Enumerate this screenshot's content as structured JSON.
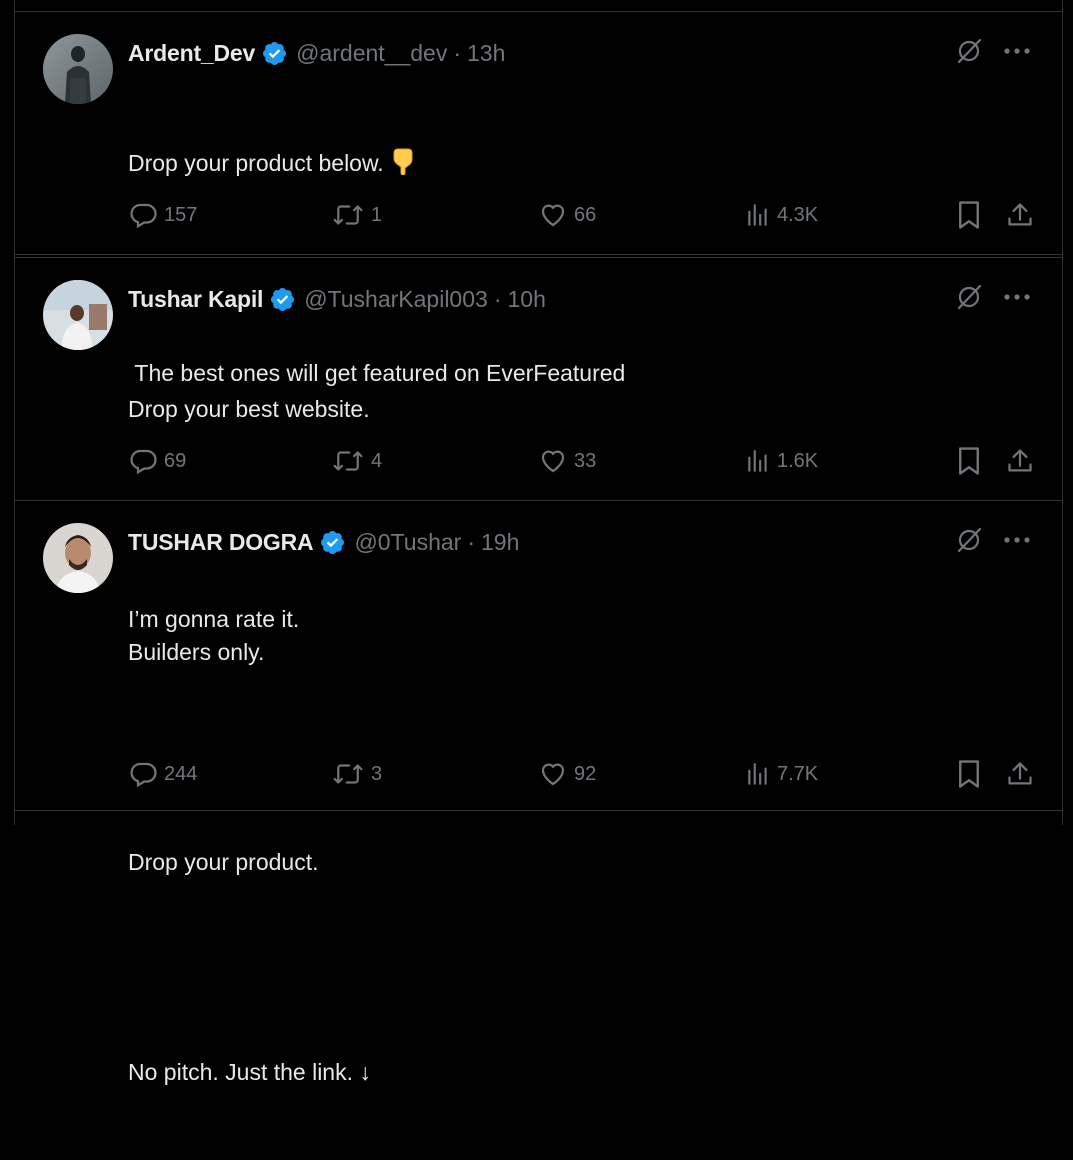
{
  "tweets": [
    {
      "display_name": "Ardent_Dev",
      "handle": "@ardent__dev",
      "separator": "·",
      "time": "13h",
      "lines": [
        "Drop your product below.",
        "",
        " The best ones will get featured on EverFeatured"
      ],
      "emoji": "👇",
      "replies": "157",
      "retweets": "1",
      "likes": "66",
      "views": "4.3K"
    },
    {
      "display_name": "Tushar Kapil",
      "handle": "@TusharKapil003",
      "separator": "·",
      "time": "10h",
      "lines": [
        "Drop your best website.",
        "",
        "I’m gonna rate it."
      ],
      "replies": "69",
      "retweets": "4",
      "likes": "33",
      "views": "1.6K"
    },
    {
      "display_name": "TUSHAR DOGRA",
      "handle": "@0Tushar",
      "separator": "·",
      "time": "19h",
      "lines": [
        "Builders only.",
        "",
        "Drop your product.",
        "",
        "No pitch. Just the link. ↓"
      ],
      "replies": "244",
      "retweets": "3",
      "likes": "92",
      "views": "7.7K"
    }
  ],
  "colors": {
    "background": "#000000",
    "text": "#e7e9ea",
    "muted": "#71767b",
    "border": "#2f3336",
    "verified": "#1d9bf0"
  },
  "icons": [
    "verified-badge-icon",
    "grok-icon",
    "more-icon",
    "reply-icon",
    "retweet-icon",
    "like-icon",
    "views-icon",
    "bookmark-icon",
    "share-icon",
    "finger-down-emoji"
  ]
}
